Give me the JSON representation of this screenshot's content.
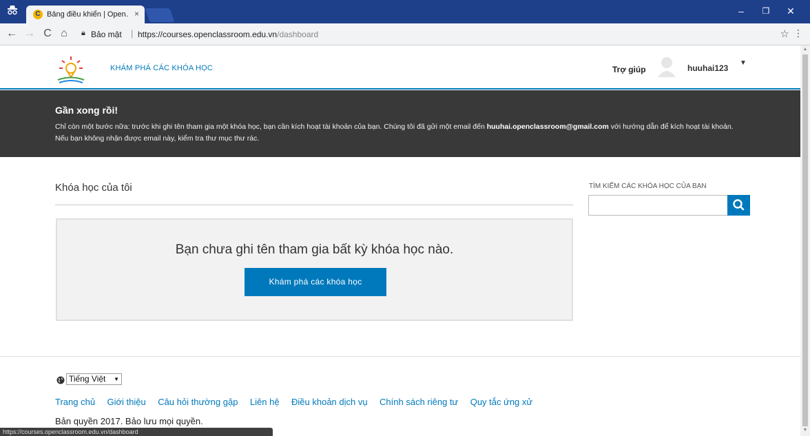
{
  "browser": {
    "tab_title": "Bảng điều khiển | Open…",
    "tab_close": "×",
    "secure_label": "Bảo mật",
    "url_host": "https://courses.openclassroom.edu.vn",
    "url_path": "/dashboard",
    "status_url": "https://courses.openclassroom.edu.vn/dashboard"
  },
  "header": {
    "explore_label": "KHÁM PHÁ CÁC KHÓA HỌC",
    "help_label": "Trợ giúp",
    "username": "huuhai123"
  },
  "banner": {
    "title": "Gần xong rồi!",
    "text_before": "Chỉ còn một bước nữa: trước khi ghi tên tham gia một khóa học, bạn cần kích hoạt tài khoản của bạn. Chúng tôi đã gửi một email đến ",
    "email": "huuhai.openclassroom@gmail.com",
    "text_after": " với hướng dẫn để kích hoạt tài khoản. Nếu bạn không nhận được email này, kiểm tra thư mục thư rác."
  },
  "main": {
    "my_courses_title": "Khóa học của tôi",
    "empty_message": "Bạn chưa ghi tên tham gia bất kỳ khóa học nào.",
    "explore_button": "Khám phá các khóa học"
  },
  "search": {
    "label": "TÌM KIẾM CÁC KHÓA HỌC CỦA BẠN",
    "value": "",
    "placeholder": ""
  },
  "footer": {
    "language": "Tiếng Việt",
    "links": [
      "Trang chủ",
      "Giới thiệu",
      "Câu hỏi thường gặp",
      "Liên hệ",
      "Điều khoản dịch vụ",
      "Chính sách riêng tư",
      "Quy tắc ứng xử"
    ],
    "copyright": "Bản quyền 2017. Bảo lưu mọi quyền."
  },
  "colors": {
    "brand_blue": "#0079bc",
    "banner_bg": "#393939",
    "chrome_frame": "#1e3f8a"
  }
}
